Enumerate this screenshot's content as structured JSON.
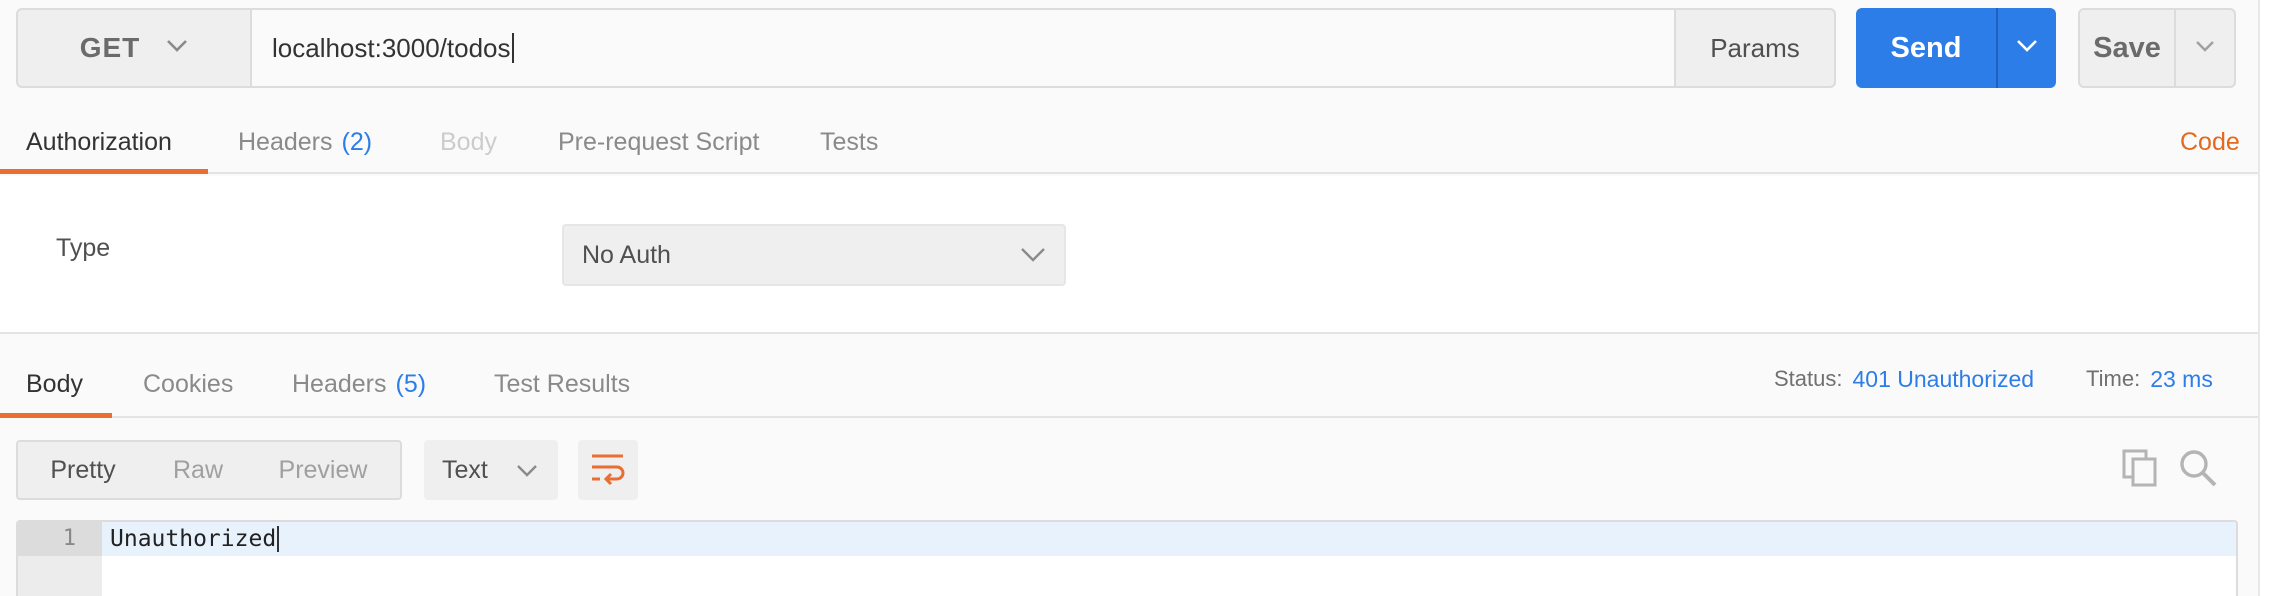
{
  "request": {
    "method": "GET",
    "url": "localhost:3000/todos",
    "params_label": "Params",
    "send_label": "Send",
    "save_label": "Save"
  },
  "request_tabs": {
    "authorization": "Authorization",
    "headers": "Headers",
    "headers_count": "(2)",
    "body": "Body",
    "prerequest": "Pre-request Script",
    "tests": "Tests",
    "code_link": "Code"
  },
  "auth": {
    "type_label": "Type",
    "type_value": "No Auth"
  },
  "response_tabs": {
    "body": "Body",
    "cookies": "Cookies",
    "headers": "Headers",
    "headers_count": "(5)",
    "test_results": "Test Results"
  },
  "response_status": {
    "status_label": "Status:",
    "status_value": "401 Unauthorized",
    "time_label": "Time:",
    "time_value": "23 ms"
  },
  "response_view": {
    "pretty": "Pretty",
    "raw": "Raw",
    "preview": "Preview",
    "format": "Text"
  },
  "editor": {
    "lines": [
      {
        "number": "1",
        "text": "Unauthorized"
      }
    ]
  },
  "colors": {
    "accent_orange": "#ea6d32",
    "send_blue": "#2d7de8",
    "link_blue": "#2d7de8"
  },
  "icons": {
    "method_dropdown": "chevron-down-icon",
    "send_dropdown": "chevron-down-icon",
    "save_dropdown": "chevron-down-icon",
    "auth_dropdown": "chevron-down-icon",
    "format_dropdown": "chevron-down-icon",
    "wrap": "wrap-lines-icon",
    "copy": "copy-icon",
    "search": "search-icon"
  }
}
